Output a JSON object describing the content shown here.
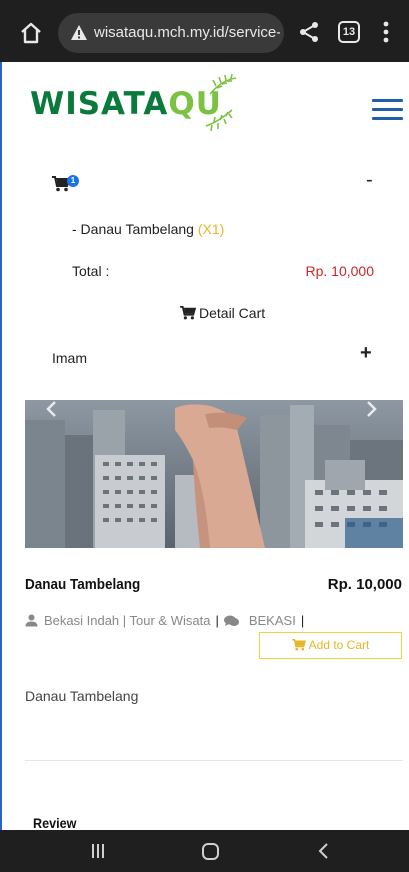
{
  "browser": {
    "url": "wisataqu.mch.my.id/service-detail",
    "tab_count": "13"
  },
  "site": {
    "logo_main": "WISATA",
    "logo_accent": "QU",
    "brand_green": "#0a7a3c",
    "brand_light_green": "#7cc242"
  },
  "cart": {
    "badge_count": "1",
    "collapse_symbol": "-",
    "item_name": "- Danau Tambelang",
    "item_qty": "(X1)",
    "total_label": "Total :",
    "total_value": "Rp. 10,000",
    "detail_label": "Detail Cart"
  },
  "user": {
    "name": "Imam",
    "expand_symbol": "+"
  },
  "product": {
    "name": "Danau Tambelang",
    "price": "Rp. 10,000",
    "vendor": "Bekasi Indah | Tour & Wisata",
    "separator": "|",
    "city": "BEKASI",
    "add_to_cart_label": "Add to Cart",
    "description": "Danau Tambelang"
  },
  "review": {
    "heading": "Review"
  },
  "colors": {
    "price_red": "#c62828",
    "accent_yellow": "#e8b526",
    "nav_blue": "#1f5fa8"
  },
  "icons": [
    "home-icon",
    "warning-icon",
    "share-icon",
    "tabs-icon",
    "more-vert-icon",
    "hamburger-icon",
    "cart-icon",
    "user-icon",
    "comments-icon",
    "chevron-left-icon",
    "chevron-right-icon",
    "recent-apps-icon",
    "nav-home-icon",
    "nav-back-icon"
  ]
}
